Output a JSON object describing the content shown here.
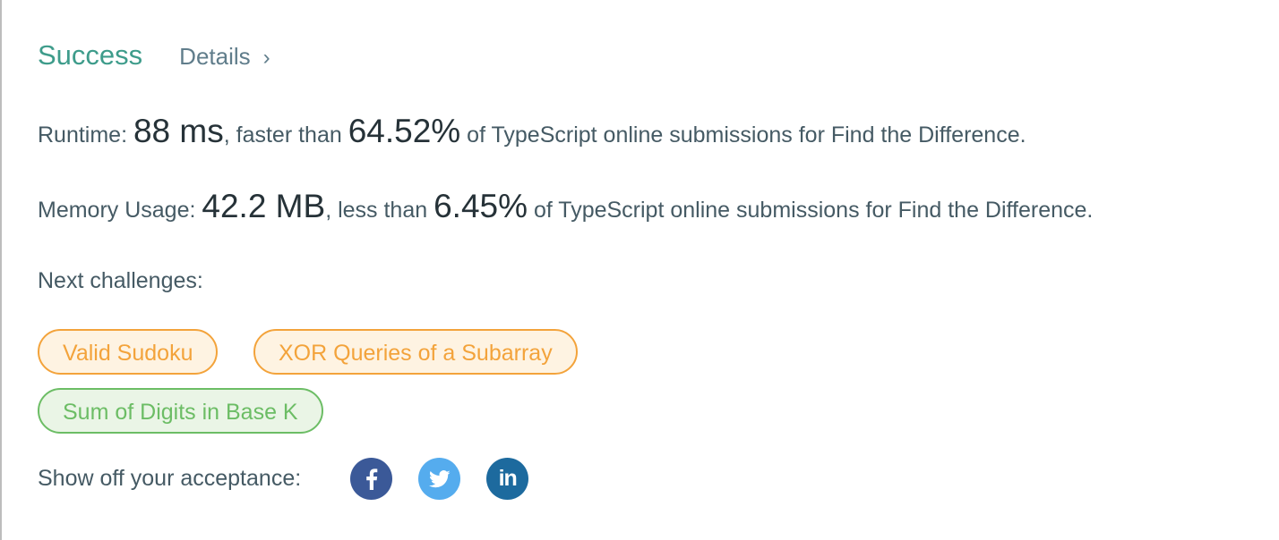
{
  "header": {
    "status": "Success",
    "details_label": "Details",
    "details_chevron": "›"
  },
  "runtime": {
    "label": "Runtime: ",
    "value": "88 ms",
    "mid": ", faster than ",
    "percent": "64.52%",
    "suffix": " of TypeScript online submissions for Find the Difference."
  },
  "memory": {
    "label": "Memory Usage: ",
    "value": "42.2 MB",
    "mid": ", less than ",
    "percent": "6.45%",
    "suffix": " of TypeScript online submissions for Find the Difference."
  },
  "next": {
    "label": "Next challenges:",
    "challenges": [
      {
        "title": "Valid Sudoku",
        "difficulty_color": "#f3a33b"
      },
      {
        "title": "XOR Queries of a Subarray",
        "difficulty_color": "#f3a33b"
      },
      {
        "title": "Sum of Digits in Base K",
        "difficulty_color": "#6cbd65"
      }
    ]
  },
  "share": {
    "label": "Show off your acceptance:",
    "buttons": [
      {
        "icon": "facebook-icon",
        "color": "#3b5998"
      },
      {
        "icon": "twitter-icon",
        "color": "#55acee"
      },
      {
        "icon": "linkedin-icon",
        "color": "#1d6a9e",
        "glyph": "in"
      }
    ]
  },
  "colors": {
    "success": "#3e9c8b",
    "medium": "#f3a33b",
    "easy": "#6cbd65"
  }
}
